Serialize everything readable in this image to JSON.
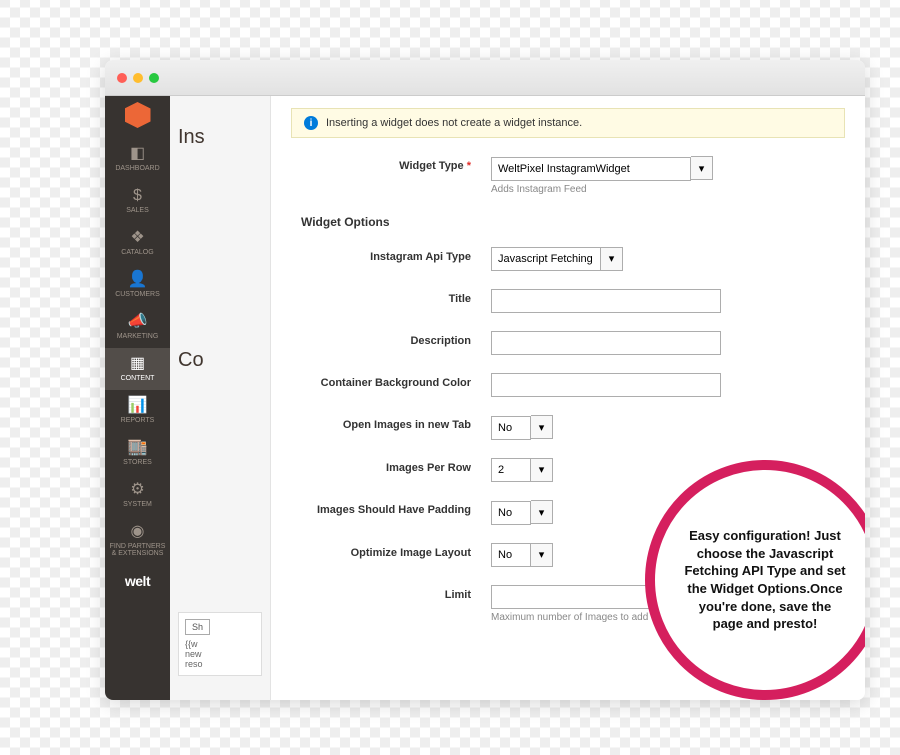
{
  "sidebar": {
    "items": [
      {
        "label": "Dashboard",
        "icon": "◧"
      },
      {
        "label": "Sales",
        "icon": "$"
      },
      {
        "label": "Catalog",
        "icon": "❖"
      },
      {
        "label": "Customers",
        "icon": "👤"
      },
      {
        "label": "Marketing",
        "icon": "📣"
      },
      {
        "label": "Content",
        "icon": "▦"
      },
      {
        "label": "Reports",
        "icon": "📊"
      },
      {
        "label": "Stores",
        "icon": "🏬"
      },
      {
        "label": "System",
        "icon": "⚙"
      },
      {
        "label": "Find Partners & Extensions",
        "icon": "◉"
      }
    ],
    "brand": "welt"
  },
  "partial": {
    "title": "Ins",
    "sec2": "Co",
    "sh": "Sh",
    "snippet": "{{w\nnew\nreso"
  },
  "notice": {
    "text": "Inserting a widget does not create a widget instance."
  },
  "form": {
    "widget_type_label": "Widget Type",
    "widget_type_value": "WeltPixel InstagramWidget",
    "widget_type_hint": "Adds Instagram Feed",
    "options_heading": "Widget Options",
    "api_type_label": "Instagram Api Type",
    "api_type_value": "Javascript Fetching",
    "title_label": "Title",
    "title_value": "",
    "desc_label": "Description",
    "desc_value": "",
    "bg_label": "Container Background Color",
    "bg_value": "",
    "newtab_label": "Open Images in new Tab",
    "newtab_value": "No",
    "perrow_label": "Images Per Row",
    "perrow_value": "2",
    "padding_label": "Images Should Have Padding",
    "padding_value": "No",
    "optimize_label": "Optimize Image Layout",
    "optimize_value": "No",
    "limit_label": "Limit",
    "limit_value": "",
    "limit_hint": "Maximum number of Images to add"
  },
  "callout": "Easy configuration! Just choose the Javascript Fetching API Type and set the Widget Options.Once you're done, save the page and presto!"
}
